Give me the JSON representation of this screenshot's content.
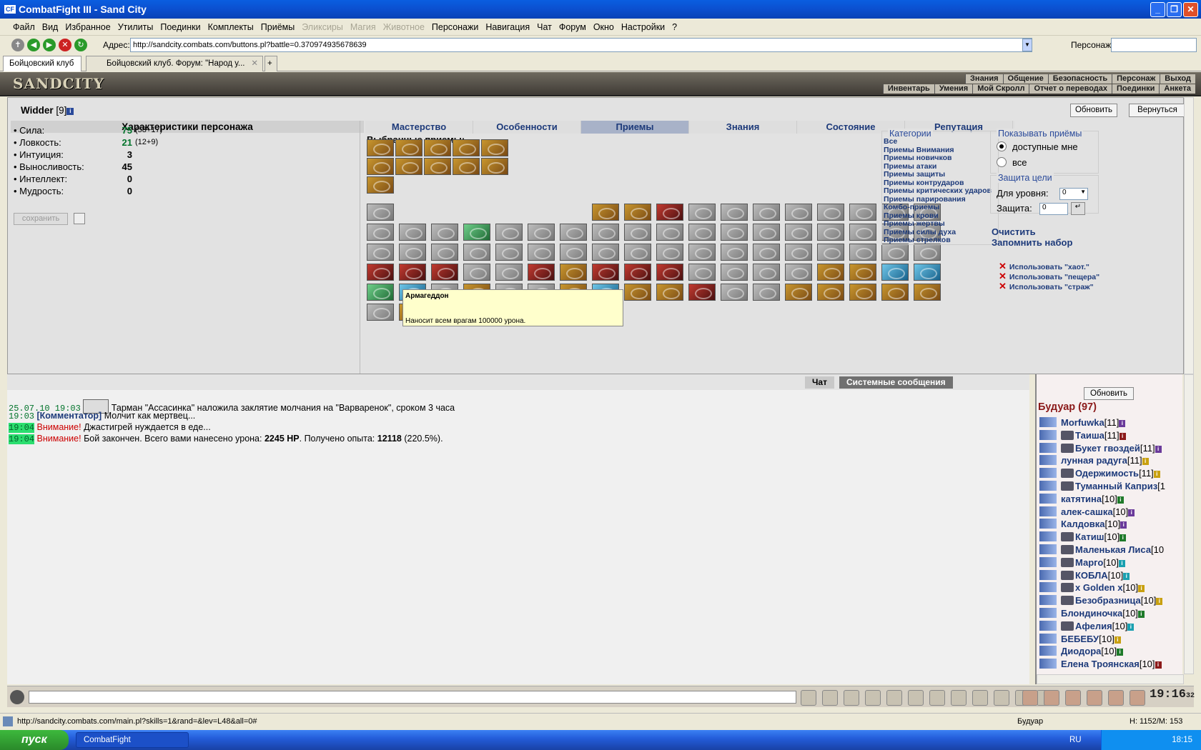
{
  "window": {
    "title": "CombatFight III - Sand City",
    "logo": "CF"
  },
  "menu": [
    "Файл",
    "Вид",
    "Избранное",
    "Утилиты",
    "Поединки",
    "Комплекты",
    "Приёмы",
    "Эликсиры",
    "Магия",
    "Животное",
    "Персонажи",
    "Навигация",
    "Чат",
    "Форум",
    "Окно",
    "Настройки",
    "?"
  ],
  "menu_disabled": [
    "Эликсиры",
    "Магия",
    "Животное"
  ],
  "addressbar": {
    "label": "Адрес:",
    "url": "http://sandcity.combats.com/buttons.pl?battle=0.370974935678639",
    "pers_label": "Персонаж:"
  },
  "tabs": [
    "Бойцовский клуб",
    "Бойцовский клуб. Форум: \"Народ у..."
  ],
  "game_header": {
    "logo": "SANDCITY",
    "menu_row1": [
      "Знания",
      "Общение",
      "Безопасность",
      "Персонаж",
      "Выход"
    ],
    "menu_row2": [
      "Инвентарь",
      "Умения",
      "Мой Скролл",
      "Отчет о переводах",
      "Поединки",
      "Анкета"
    ]
  },
  "character": {
    "name": "Widder",
    "level": "[9]",
    "stats_title": "Характеристики персонажа",
    "stats": [
      {
        "label": "• Сила:",
        "value": "75",
        "extra": "(58+17)",
        "green": true
      },
      {
        "label": "• Ловкость:",
        "value": "21",
        "extra": "(12+9)",
        "green": true
      },
      {
        "label": "• Интуиция:",
        "value": "3",
        "extra": "",
        "green": false
      },
      {
        "label": "• Выносливость:",
        "value": "45",
        "extra": "",
        "green": false
      },
      {
        "label": "• Интеллект:",
        "value": "0",
        "extra": "",
        "green": false
      },
      {
        "label": "• Мудрость:",
        "value": "0",
        "extra": "",
        "green": false
      }
    ],
    "save_label": "сохранить"
  },
  "section_tabs": [
    "Мастерство",
    "Особенности",
    "Приемы",
    "Знания",
    "Состояние",
    "Репутация"
  ],
  "active_tab": "Приемы",
  "selected_label": "Выбранные приемы:",
  "tooltip": {
    "title": "Армагеддон",
    "description": "Наносит всем врагам 100000 урона."
  },
  "buttons": {
    "refresh": "Обновить",
    "back": "Вернуться"
  },
  "categories": {
    "legend": "Категории",
    "items": [
      "Все",
      "Приемы Внимания",
      "Приемы новичков",
      "Приемы атаки",
      "Приемы защиты",
      "Приемы контрударов",
      "Приемы критических ударов",
      "Приемы парирования",
      "Комбо-приемы",
      "Приемы крови",
      "Приемы жертвы",
      "Приемы силы духа",
      "Приемы стрелков"
    ]
  },
  "show": {
    "legend": "Показывать приёмы",
    "opt1": "доступные мне",
    "opt2": "все"
  },
  "protect": {
    "legend": "Защита цели",
    "level_label": "Для уровня:",
    "level_value": "0",
    "prot_label": "Защита:",
    "prot_value": "0"
  },
  "actions": {
    "clear": "Очистить",
    "remember": "Запомнить набор"
  },
  "use_links": [
    "Использовать \"хаот.\"",
    "Использовать \"пещера\"",
    "Использовать \"страж\""
  ],
  "chat": {
    "tab_chat": "Чат",
    "tab_sys": "Системные сообщения",
    "lines": [
      {
        "ts": "25.07.10 19:03",
        "text": "Тарман \"Ассасинка\" наложила заклятие молчания на \"Варваренок\", сроком 3 часа"
      },
      {
        "ts": "19:03",
        "kom": "[Комментатор]",
        "text": "Молчит как мертвец..."
      },
      {
        "ts": "19:04",
        "warn": "Внимание!",
        "text": "Джастигрей нуждается в еде..."
      },
      {
        "ts": "19:04",
        "warn": "Внимание!",
        "text_a": "Бой закончен. Всего вами нанесено урона:",
        "dmg": "2245 HP",
        "text_b": ". Получено опыта:",
        "exp": "12118",
        "pct": "(220.5%)."
      }
    ]
  },
  "room": {
    "refresh": "Обновить",
    "title": "Будуар (97)",
    "users": [
      {
        "name": "Morfuwka",
        "lvl": "[11]",
        "i": "p",
        "clan": false
      },
      {
        "name": "Таиша",
        "lvl": "[11]",
        "i": "r",
        "clan": true
      },
      {
        "name": "Букет гвоздей",
        "lvl": "[11]",
        "i": "p",
        "clan": true
      },
      {
        "name": "лунная радуга",
        "lvl": "[11]",
        "i": "y",
        "clan": false
      },
      {
        "name": "Одержимость",
        "lvl": "[11]",
        "i": "y",
        "clan": true
      },
      {
        "name": "Туманный Каприз",
        "lvl": "[1",
        "i": "",
        "clan": true
      },
      {
        "name": "катятина",
        "lvl": "[10]",
        "i": "g",
        "clan": false
      },
      {
        "name": "алек-сашка",
        "lvl": "[10]",
        "i": "p",
        "clan": false
      },
      {
        "name": "Калдовка",
        "lvl": "[10]",
        "i": "p",
        "clan": false
      },
      {
        "name": "Катиш",
        "lvl": "[10]",
        "i": "g",
        "clan": true
      },
      {
        "name": "Маленькая Лиса",
        "lvl": "[10",
        "i": "",
        "clan": true
      },
      {
        "name": "Марго",
        "lvl": "[10]",
        "i": "c",
        "clan": true
      },
      {
        "name": "КОБЛА",
        "lvl": "[10]",
        "i": "c",
        "clan": true
      },
      {
        "name": "x Golden x",
        "lvl": "[10]",
        "i": "y",
        "clan": true
      },
      {
        "name": "Безобразница",
        "lvl": "[10]",
        "i": "y",
        "clan": true
      },
      {
        "name": "Блондиночка",
        "lvl": "[10]",
        "i": "g",
        "clan": false
      },
      {
        "name": "Афелия",
        "lvl": "[10]",
        "i": "c",
        "clan": true
      },
      {
        "name": "БЕБЕБУ",
        "lvl": "[10]",
        "i": "y",
        "clan": false
      },
      {
        "name": "Диодора",
        "lvl": "[10]",
        "i": "g",
        "clan": false
      },
      {
        "name": "Елена Троянская",
        "lvl": "[10]",
        "i": "r",
        "clan": false
      }
    ]
  },
  "clock": "19:16",
  "clock_sec": "32",
  "status": {
    "url": "http://sandcity.combats.com/main.pl?skills=1&rand=&lev=L48&all=0#",
    "room": "Будуар",
    "hp": "H: 1152/M: 153"
  },
  "taskbar": {
    "start": "пуск",
    "item": "CombatFight",
    "lang": "RU",
    "time": "18:15"
  },
  "colors": {
    "titlebar": "#0b4fcf",
    "link": "#1d3a7a",
    "warn": "#cc0000",
    "room_title": "#8b1a1a"
  }
}
